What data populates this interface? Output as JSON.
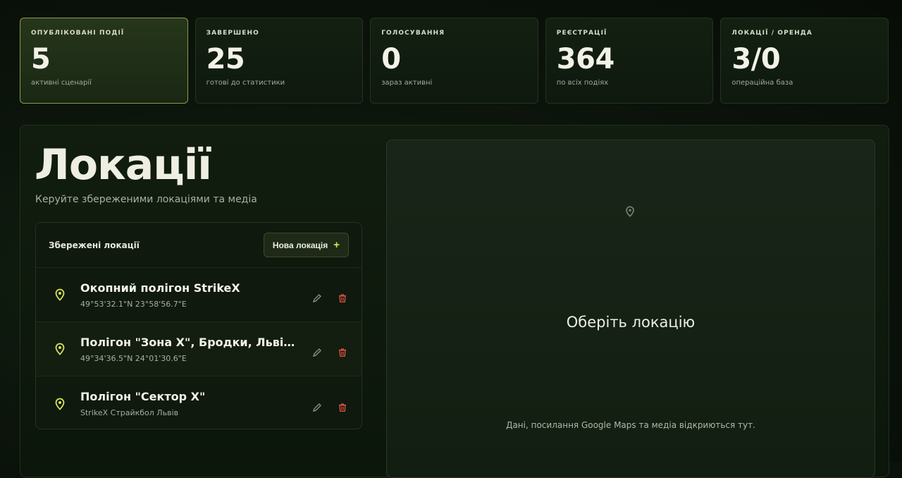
{
  "stats": [
    {
      "label": "ОПУБЛІКОВАНІ ПОДІЇ",
      "value": "5",
      "sub": "активні сценарії"
    },
    {
      "label": "ЗАВЕРШЕНО",
      "value": "25",
      "sub": "готові до статистики"
    },
    {
      "label": "ГОЛОСУВАННЯ",
      "value": "0",
      "sub": "зараз активні"
    },
    {
      "label": "РЕЄСТРАЦІЇ",
      "value": "364",
      "sub": "по всіх подіях"
    },
    {
      "label": "ЛОКАЦІЇ / ОРЕНДА",
      "value": "3/0",
      "sub": "операційна база"
    }
  ],
  "page": {
    "title": "Локації",
    "subtitle": "Керуйте збереженими локаціями та медіа"
  },
  "list": {
    "header": "Збережені локації",
    "new_button": "Нова локація",
    "items": [
      {
        "name": "Окопний полігон StrikeX",
        "meta": "49°53'32.1\"N 23°58'56.7\"E"
      },
      {
        "name": "Полігон \"Зона Х\", Бродки, Львівська область",
        "meta": "49°34'36.5\"N 24°01'30.6\"E"
      },
      {
        "name": "Полігон \"Сектор Х\"",
        "meta": "StrikeX Страйкбол Львів"
      }
    ]
  },
  "detail": {
    "title": "Оберіть локацію",
    "hint": "Дані, посилання Google Maps та медіа відкриються тут."
  },
  "colors": {
    "accent": "#d7e25a",
    "delete": "#e0503f",
    "background": "#0b120b"
  },
  "icons": {
    "location": "map-pin-icon",
    "edit": "pencil-icon",
    "delete": "trash-icon",
    "add": "plus-icon"
  }
}
